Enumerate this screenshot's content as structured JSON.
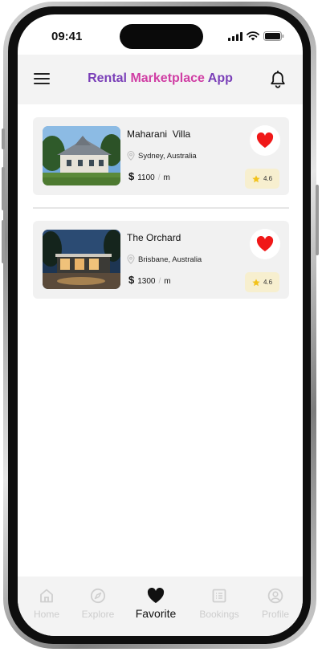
{
  "status_bar": {
    "time": "09:41"
  },
  "header": {
    "title_part1": "Rental ",
    "title_part2": "Marketplace",
    "title_part3": " App"
  },
  "listings": [
    {
      "name": "Maharani  Villa",
      "location": "Sydney, Australia",
      "currency": "$",
      "price": "1100",
      "unit": "m",
      "rating": "4.6",
      "favorited": true
    },
    {
      "name": "The Orchard",
      "location": "Brisbane, Australia",
      "currency": "$",
      "price": "1300",
      "unit": "m",
      "rating": "4.6",
      "favorited": true
    }
  ],
  "bottom_nav": {
    "items": [
      {
        "label": "Home",
        "icon": "home-icon",
        "active": false
      },
      {
        "label": "Explore",
        "icon": "compass-icon",
        "active": false
      },
      {
        "label": "Favorite",
        "icon": "heart-icon",
        "active": true
      },
      {
        "label": "Bookings",
        "icon": "list-icon",
        "active": false
      },
      {
        "label": "Profile",
        "icon": "user-icon",
        "active": false
      }
    ]
  },
  "colors": {
    "title_purple": "#7a3fb8",
    "title_pink": "#d03ea4",
    "favorite_red": "#f01818",
    "rating_bg": "#f7efcf",
    "star_yellow": "#f2c21b"
  }
}
